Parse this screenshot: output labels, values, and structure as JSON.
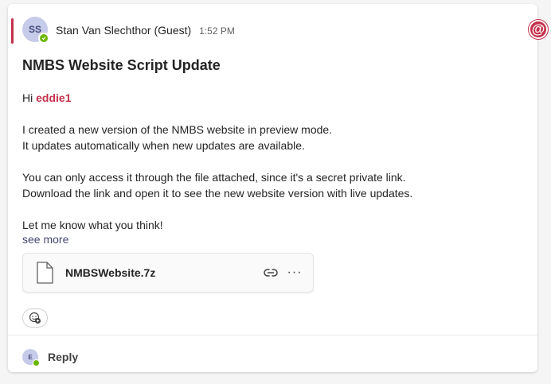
{
  "message": {
    "sender_initials": "SS",
    "sender_name": "Stan Van Slechthor (Guest)",
    "timestamp": "1:52 PM",
    "mention_icon": "@",
    "subject": "NMBS Website Script Update",
    "greeting": "Hi",
    "mention_name": "eddie1",
    "paragraphs": [
      "I created a new version of the NMBS website in preview mode.",
      "It updates automatically when new updates are available.",
      "You can only access it through the file attached, since it's a secret private link.",
      "Download the link and open it to see the new website version with live updates.",
      "Let me know what you think!"
    ],
    "see_more": "see more"
  },
  "attachment": {
    "file_name": "NMBSWebsite.7z",
    "more_label": "···"
  },
  "reply": {
    "avatar_initial": "E",
    "label": "Reply"
  },
  "colors": {
    "accent": "#c4314b",
    "presence": "#6bb700",
    "link": "#464775"
  }
}
